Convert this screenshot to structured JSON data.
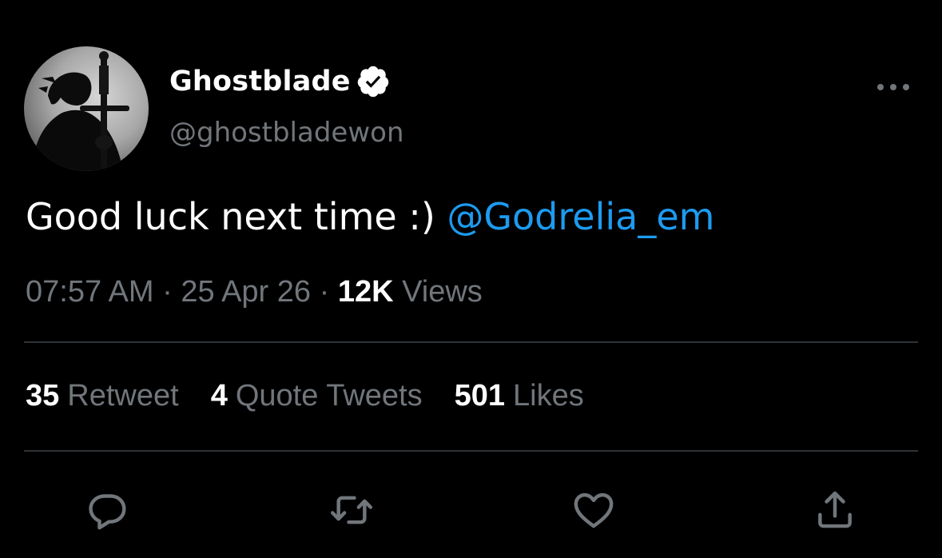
{
  "user": {
    "display_name": "Ghostblade",
    "handle": "@ghostbladewon",
    "verified": true
  },
  "tweet": {
    "text": "Good luck next time :) ",
    "mention": "@Godrelia_em"
  },
  "meta": {
    "time": "07:57 AM",
    "separator": "·",
    "date": "25 Apr 26",
    "views_count": "12K",
    "views_label": "Views"
  },
  "stats": {
    "retweets": {
      "count": "35",
      "label": "Retweet"
    },
    "quotes": {
      "count": "4",
      "label": "Quote Tweets"
    },
    "likes": {
      "count": "501",
      "label": "Likes"
    }
  },
  "icons": {
    "more": "more-horizontal-icon",
    "reply": "reply-icon",
    "retweet": "retweet-icon",
    "like": "heart-icon",
    "share": "share-icon",
    "verified": "verified-badge-icon"
  },
  "colors": {
    "background": "#000000",
    "text": "#ffffff",
    "secondary": "#71767b",
    "link": "#1d9bf0",
    "divider": "#2f3336"
  }
}
